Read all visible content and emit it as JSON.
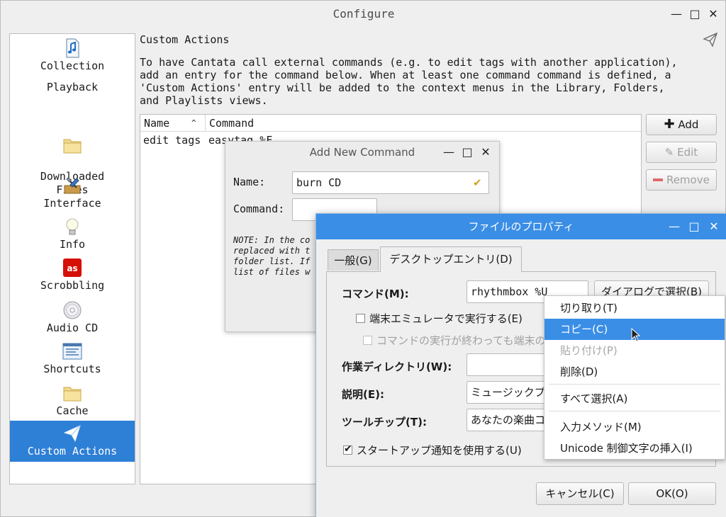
{
  "window": {
    "title": "Configure"
  },
  "sidebar": {
    "items": [
      {
        "label": "Collection",
        "icon": "music-file-icon"
      },
      {
        "label": "Playback",
        "icon": ""
      },
      {
        "label": "Downloaded\nFiles",
        "icon": "folder-icon"
      },
      {
        "label": "Interface",
        "icon": "tools-icon"
      },
      {
        "label": "Info",
        "icon": "lightbulb-icon"
      },
      {
        "label": "Scrobbling",
        "icon": "lastfm-icon"
      },
      {
        "label": "Audio CD",
        "icon": "cd-icon"
      },
      {
        "label": "Shortcuts",
        "icon": "shortcuts-icon"
      },
      {
        "label": "Cache",
        "icon": "folder-icon"
      },
      {
        "label": "Custom Actions",
        "icon": "send-icon"
      }
    ],
    "selected": "Custom Actions"
  },
  "page": {
    "title": "Custom Actions",
    "description": [
      "To have Cantata call external commands (e.g. to edit tags with another application),",
      "add an entry for the command below. When at least one command command is defined, a",
      "'Custom Actions' entry will be added to the context menus in the Library, Folders,",
      "and Playlists views."
    ],
    "table": {
      "columns": [
        "Name",
        "Command"
      ],
      "rows": [
        {
          "name": "edit tags",
          "command": "easytag %F"
        }
      ]
    },
    "buttons": {
      "add": "Add",
      "edit": "Edit",
      "remove": "Remove"
    }
  },
  "add_dialog": {
    "title": "Add New Command",
    "name_label": "Name:",
    "name_value": "burn CD",
    "command_label": "Command:",
    "command_value": "",
    "note": [
      "NOTE: In the co",
      "replaced with t",
      "folder list. If",
      "list of files w"
    ]
  },
  "props_dialog": {
    "title": "ファイルのプロパティ",
    "tabs": [
      "一般(G)",
      "デスクトップエントリ(D)"
    ],
    "active_tab": "デスクトップエントリ(D)",
    "command_label": "コマンド(M):",
    "command_value": "rhythmbox %U",
    "browse_button": "ダイアログで選択(B)",
    "run_in_terminal": "端末エミュレータで実行する(E)",
    "keep_terminal": "コマンドの実行が終わっても端末の",
    "workdir_label": "作業ディレクトリ(W):",
    "workdir_value": "",
    "desc_label": "説明(E):",
    "desc_value": "ミュージックプ",
    "tooltip_label": "ツールチップ(T):",
    "tooltip_value": "あなたの楽曲コ",
    "startup_notify": "スタートアップ通知を使用する(U)",
    "startup_checked": true,
    "cancel_button": "キャンセル(C)",
    "ok_button": "OK(O)"
  },
  "context_menu": {
    "items": [
      {
        "label": "切り取り(T)",
        "state": "normal"
      },
      {
        "label": "コピー(C)",
        "state": "highlighted"
      },
      {
        "label": "貼り付け(P)",
        "state": "disabled"
      },
      {
        "label": "削除(D)",
        "state": "normal"
      },
      {
        "label": "すべて選択(A)",
        "state": "normal"
      },
      {
        "label": "入力メソッド(M)",
        "state": "normal"
      },
      {
        "label": "Unicode 制御文字の挿入(I)",
        "state": "normal"
      }
    ]
  },
  "colors": {
    "accent": "#3a8ee6",
    "selection": "#2e7fd6"
  }
}
